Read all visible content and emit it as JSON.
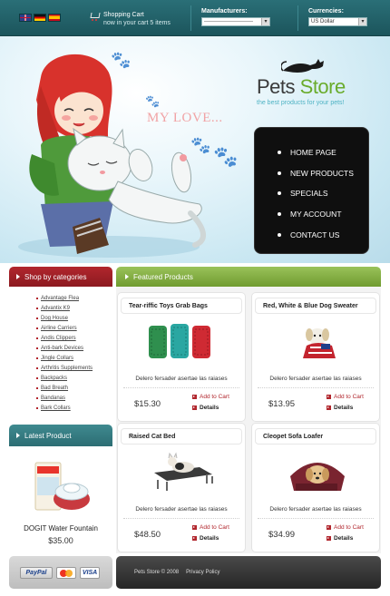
{
  "topbar": {
    "languages": [
      "English",
      "Deutsch",
      "Español"
    ],
    "cart": {
      "title": "Shopping Cart",
      "status": "now in your cart 5 items"
    },
    "manufacturers": {
      "label": "Manufacturers:",
      "value": "---------------------------"
    },
    "currencies": {
      "label": "Currencies:",
      "value": "US Dollar"
    }
  },
  "hero": {
    "brand_part1": "Pets ",
    "brand_part2": "Store",
    "tagline": "the best products for your pets!",
    "handwritten": "MY LOVE..."
  },
  "nav": [
    "HOME PAGE",
    "NEW PRODUCTS",
    "SPECIALS",
    "MY ACCOUNT",
    "CONTACT US"
  ],
  "categories": {
    "title": "Shop by categories",
    "items": [
      "Advantage Flea",
      "Advantix K9",
      "Dog House",
      "Airline Carriers",
      "Andis Clippers",
      "Anti-bark Devices",
      "Jingle Collars",
      "Arthritis Supplements",
      "Backpacks",
      "Bad Breath",
      "Bandanas",
      "Bark Collars"
    ]
  },
  "latest": {
    "title": "Latest Product",
    "name": "DOGIT Water Fountain",
    "price": "$35.00"
  },
  "featured": {
    "title": "Featured Products",
    "add_label": "Add to Cart",
    "details_label": "Details",
    "products": [
      {
        "name": "Tear-riffic Toys Grab Bags",
        "desc": "Delero fersader asertae las raiases",
        "price": "$15.30"
      },
      {
        "name": "Red, White & Blue Dog Sweater",
        "desc": "Delero fersader asertae las raiases",
        "price": "$13.95"
      },
      {
        "name": "Raised Cat Bed",
        "desc": "Delero fersader asertae las raiases",
        "price": "$48.50"
      },
      {
        "name": "Cleopet Sofa Loafer",
        "desc": "Delero fersader asertae las raiases",
        "price": "$34.99"
      }
    ]
  },
  "payments": [
    "PayPal",
    "MasterCard",
    "VISA"
  ],
  "footer": {
    "copyright": "Pets Store © 2008",
    "privacy": "Privacy Policy"
  },
  "colors": {
    "teal": "#1f5e65",
    "red": "#b1262d",
    "green": "#7aa73a",
    "nav_bg": "#0f0f0f"
  }
}
